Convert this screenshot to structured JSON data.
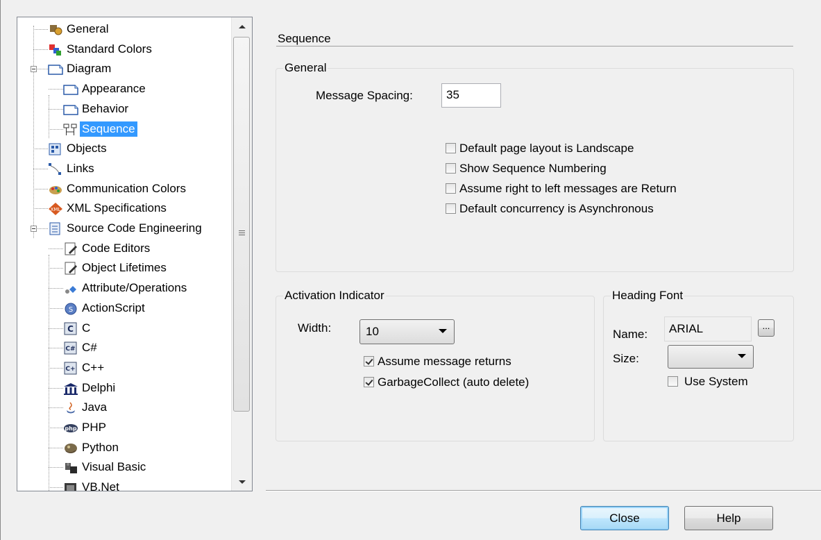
{
  "tree": {
    "items": [
      {
        "label": "General",
        "icon": "wrench-gear-icon"
      },
      {
        "label": "Standard Colors",
        "icon": "color-palette-icon"
      },
      {
        "label": "Diagram",
        "icon": "page-icon",
        "expanded": true
      },
      {
        "label": "Appearance",
        "icon": "page-icon"
      },
      {
        "label": "Behavior",
        "icon": "page-icon"
      },
      {
        "label": "Sequence",
        "icon": "sequence-icon",
        "selected": true
      },
      {
        "label": "Objects",
        "icon": "objects-icon"
      },
      {
        "label": "Links",
        "icon": "link-icon"
      },
      {
        "label": "Communication Colors",
        "icon": "communication-colors-icon"
      },
      {
        "label": "XML Specifications",
        "icon": "xml-icon"
      },
      {
        "label": "Source Code Engineering",
        "icon": "source-code-icon",
        "expanded": true
      },
      {
        "label": "Code Editors",
        "icon": "code-editor-icon"
      },
      {
        "label": "Object Lifetimes",
        "icon": "code-editor-icon"
      },
      {
        "label": "Attribute/Operations",
        "icon": "attribute-operations-icon"
      },
      {
        "label": "ActionScript",
        "icon": "actionscript-icon"
      },
      {
        "label": "C",
        "icon": "c-language-icon"
      },
      {
        "label": "C#",
        "icon": "csharp-icon"
      },
      {
        "label": "C++",
        "icon": "cpp-icon"
      },
      {
        "label": "Delphi",
        "icon": "delphi-icon"
      },
      {
        "label": "Java",
        "icon": "java-icon"
      },
      {
        "label": "PHP",
        "icon": "php-icon"
      },
      {
        "label": "Python",
        "icon": "python-icon"
      },
      {
        "label": "Visual Basic",
        "icon": "visual-basic-icon"
      },
      {
        "label": "VB.Net",
        "icon": "vbnet-icon"
      }
    ]
  },
  "page": {
    "title": "Sequence"
  },
  "general": {
    "legend": "General",
    "message_spacing_label": "Message Spacing:",
    "message_spacing_value": "35",
    "checkboxes": [
      {
        "label": "Default page layout is Landscape",
        "checked": false
      },
      {
        "label": "Show Sequence Numbering",
        "checked": false
      },
      {
        "label": "Assume right to left messages are Return",
        "checked": false
      },
      {
        "label": "Default concurrency is Asynchronous",
        "checked": false
      }
    ]
  },
  "activation": {
    "legend": "Activation Indicator",
    "width_label": "Width:",
    "width_value": "10",
    "checkboxes": [
      {
        "label": "Assume message returns",
        "checked": true
      },
      {
        "label": "GarbageCollect (auto delete)",
        "checked": true
      }
    ]
  },
  "heading_font": {
    "legend": "Heading Font",
    "name_label": "Name:",
    "name_value": "ARIAL",
    "browse_label": "...",
    "size_label": "Size:",
    "size_value": "",
    "use_system_label": "Use System",
    "use_system_checked": false
  },
  "buttons": {
    "close": "Close",
    "help": "Help"
  },
  "colors": {
    "selection": "#3399ff",
    "background": "#f0f0f0"
  }
}
